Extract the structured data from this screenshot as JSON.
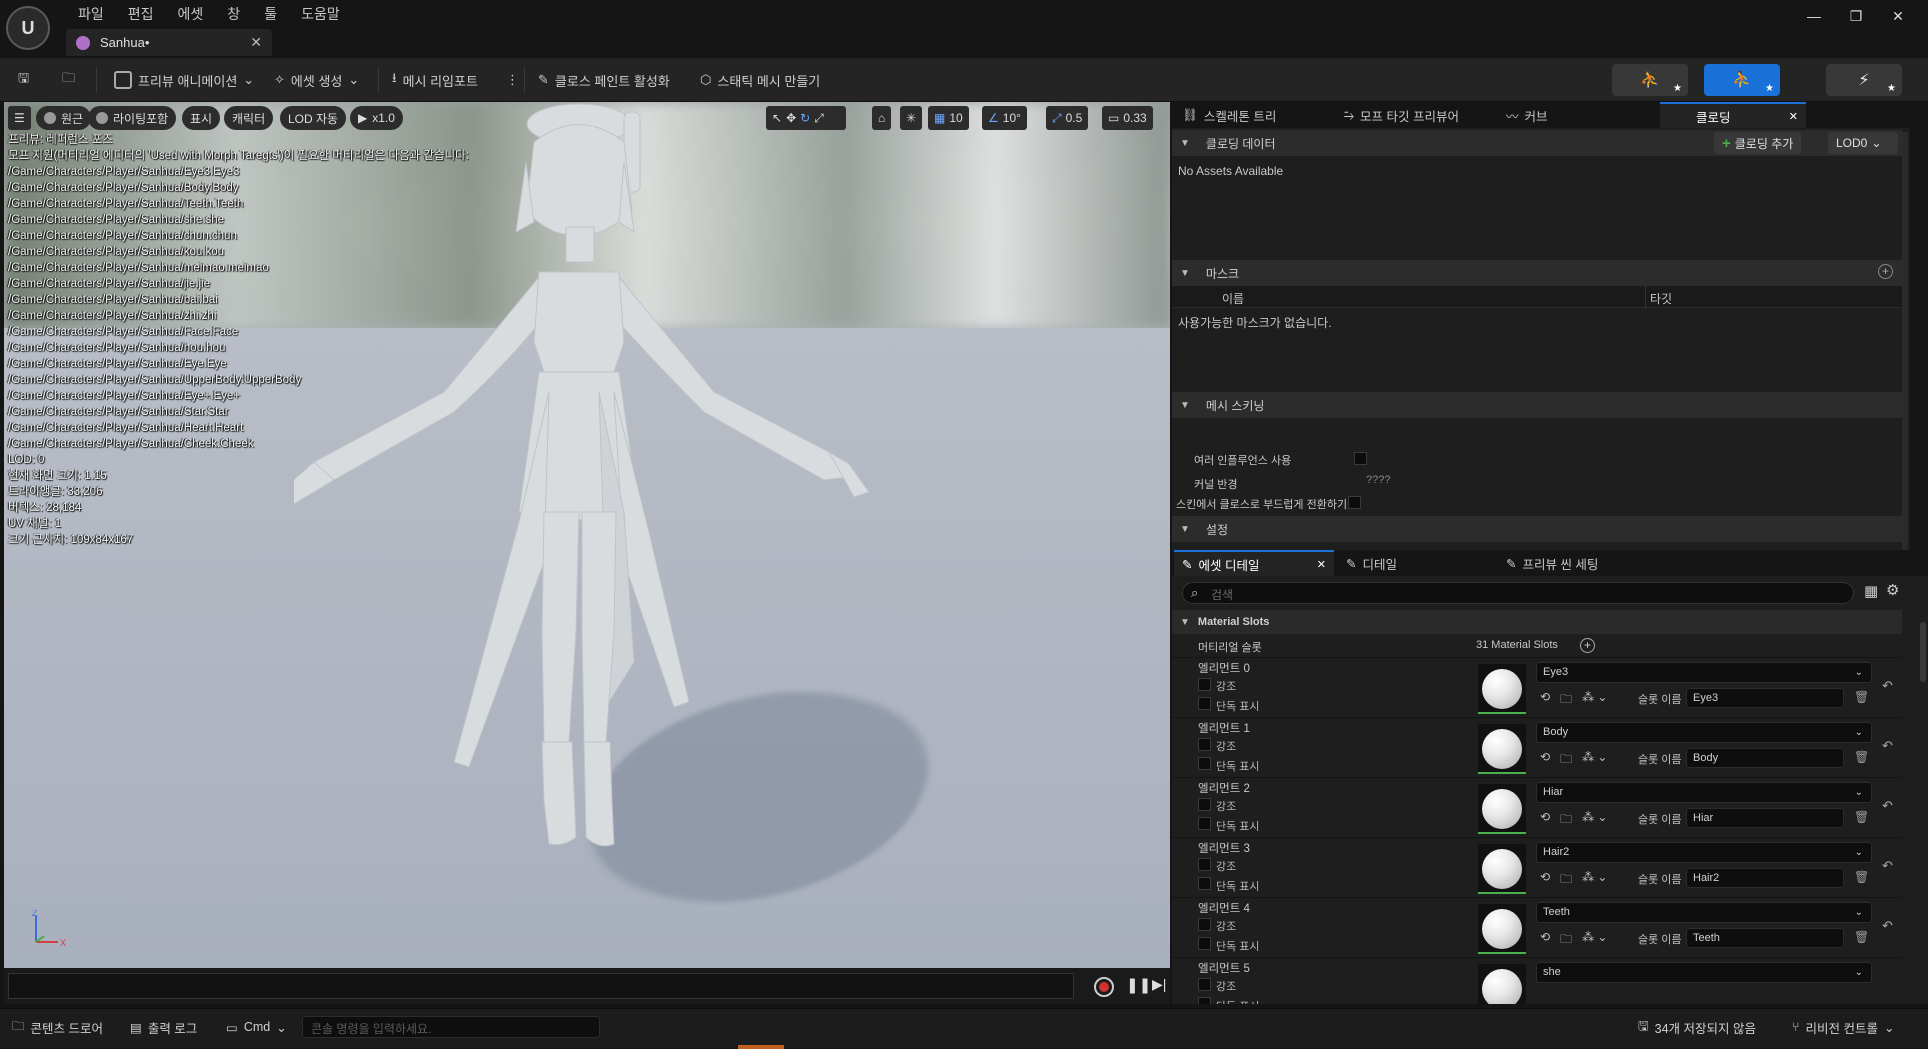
{
  "app": {
    "logo_text": "U",
    "menu": [
      "파일",
      "편집",
      "에셋",
      "창",
      "툴",
      "도움말"
    ],
    "document_tab": "Sanhua•"
  },
  "toolbar": {
    "preview_animation": "프리뷰 애니메이션",
    "create_asset": "에셋 생성",
    "reimport_mesh": "메시 리임포트",
    "activate_cloth_paint": "클로스 페인트 활성화",
    "make_static_mesh": "스태틱 메시 만들기"
  },
  "viewport": {
    "tools": {
      "perspective": "원근",
      "lighting": "라이팅포함",
      "show": "표시",
      "character": "캐릭터",
      "lod": "LOD 자동",
      "play_speed": "x1.0",
      "grid_snap": "10",
      "rot_snap": "10°",
      "scale_snap": "0.5",
      "camera_speed": "0.33"
    },
    "stats": [
      "프리뷰: 레퍼런스 포즈",
      "모프 지원(머티리얼 에디터의 'Used with Morph Taregts')이 필요한 머티리얼은 다음과 같습니다:",
      "/Game/Characters/Player/Sanhua/Eye3.Eye3",
      "/Game/Characters/Player/Sanhua/Body.Body",
      "/Game/Characters/Player/Sanhua/Teeth.Teeth",
      "/Game/Characters/Player/Sanhua/she.she",
      "/Game/Characters/Player/Sanhua/chun.chun",
      "/Game/Characters/Player/Sanhua/kou.kou",
      "/Game/Characters/Player/Sanhua/meimao.meimao",
      "/Game/Characters/Player/Sanhua/jie.jie",
      "/Game/Characters/Player/Sanhua/bai.bai",
      "/Game/Characters/Player/Sanhua/zhi.zhi",
      "/Game/Characters/Player/Sanhua/Face.Face",
      "/Game/Characters/Player/Sanhua/hou.hou",
      "/Game/Characters/Player/Sanhua/Eye.Eye",
      "/Game/Characters/Player/Sanhua/UpperBody.UpperBody",
      "/Game/Characters/Player/Sanhua/Eye+.Eye+",
      "/Game/Characters/Player/Sanhua/Star.Star",
      "/Game/Characters/Player/Sanhua/Heart.Heart",
      "/Game/Characters/Player/Sanhua/Cheek.Cheek",
      "LOD: 0",
      "현재 화면 크기: 1.15",
      "트라이앵글: 33,206",
      "버텍스: 28,184",
      "UV 채널: 1",
      "크기 근사치: 109x84x167"
    ]
  },
  "upper_panel": {
    "tabs": [
      "스켈레톤 트리",
      "모프 타깃 프리뷰어",
      "커브",
      "클로딩"
    ],
    "clothing_data": {
      "header": "클로딩 데이터",
      "add_button": "클로딩 추가",
      "lod_dropdown": "LOD0",
      "empty_text": "No Assets Available"
    },
    "mask": {
      "header": "마스크",
      "col_name": "이름",
      "col_target": "타깃",
      "empty_text": "사용가능한 마스크가 없습니다."
    },
    "mesh_skinning": {
      "header": "메시 스키닝",
      "multi_influence": "여러 인플루언스 사용",
      "kernel_radius": "커널 반경",
      "kernel_value": "????",
      "smooth_transition": "스킨에서 클로스로 부드럽게 전환하기"
    },
    "settings_header": "설정"
  },
  "lower_panel": {
    "tabs": [
      "에셋 디테일",
      "디테일",
      "프리뷰 씬 세팅"
    ],
    "search_placeholder": "검색",
    "material_slots_header": "Material Slots",
    "material_slots_label": "머티리얼 슬롯",
    "material_slots_count": "31 Material Slots",
    "highlight_label": "강조",
    "isolate_label": "단독 표시",
    "slot_name_label": "슬롯 이름",
    "slots": [
      {
        "element": "엘리먼트 0",
        "material": "Eye3",
        "slot_name": "Eye3"
      },
      {
        "element": "엘리먼트 1",
        "material": "Body",
        "slot_name": "Body"
      },
      {
        "element": "엘리먼트 2",
        "material": "Hiar",
        "slot_name": "Hiar"
      },
      {
        "element": "엘리먼트 3",
        "material": "Hair2",
        "slot_name": "Hair2"
      },
      {
        "element": "엘리먼트 4",
        "material": "Teeth",
        "slot_name": "Teeth"
      },
      {
        "element": "엘리먼트 5",
        "material": "she",
        "slot_name": ""
      }
    ]
  },
  "statusbar": {
    "content_drawer": "콘텐츠 드로어",
    "output_log": "출력 로그",
    "cmd": "Cmd",
    "console_placeholder": "콘솔 명령을 입력하세요.",
    "unsaved": "34개 저장되지 않음",
    "revision_control": "리비전 컨트롤"
  },
  "colors": {
    "accent_blue": "#1a72d8",
    "add_green": "#4caf50",
    "record_red": "#d03030"
  }
}
